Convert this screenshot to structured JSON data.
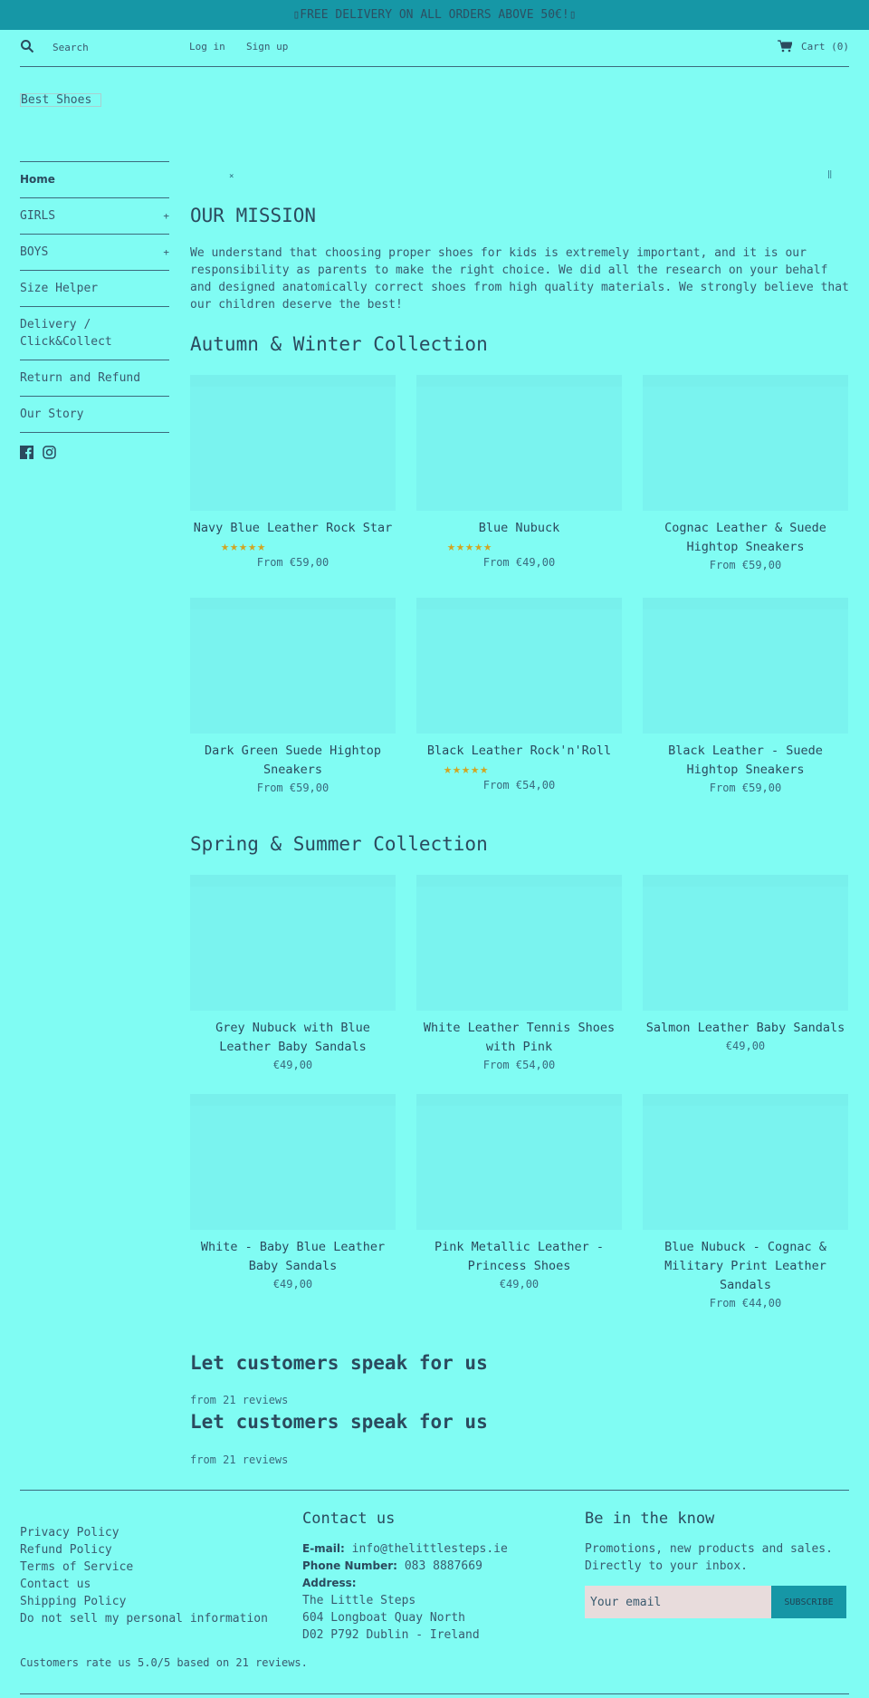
{
  "announcement": "▯FREE DELIVERY ON ALL ORDERS ABOVE 50€!▯",
  "header": {
    "search_placeholder": "Search",
    "login": "Log in",
    "signup": "Sign up",
    "cart": "Cart (0)"
  },
  "logo": "Best Shoes",
  "sidebar": {
    "items": [
      {
        "label": "Home",
        "expand": ""
      },
      {
        "label": "GIRLS",
        "expand": "+"
      },
      {
        "label": "BOYS",
        "expand": "+"
      },
      {
        "label": "Size Helper",
        "expand": ""
      },
      {
        "label": "Delivery / Click&Collect",
        "expand": ""
      },
      {
        "label": "Return and Refund",
        "expand": ""
      },
      {
        "label": "Our Story",
        "expand": ""
      }
    ],
    "social": [
      "facebook-icon",
      "instagram-icon"
    ]
  },
  "slideshow": {
    "prev_icon": "⨯",
    "pause_icon": "‖"
  },
  "mission": {
    "title": "OUR MISSION",
    "text": "We understand that choosing proper shoes for kids is extremely important, and it is our responsibility as parents to make the right choice. We did all the research on your behalf and designed anatomically correct shoes from high quality materials. We strongly believe that our children deserve the best!"
  },
  "collections": [
    {
      "title": "Autumn & Winter Collection",
      "products": [
        {
          "title": "Navy Blue Leather Rock Star",
          "stars": "★★★★★",
          "rating": 5,
          "price": "From €59,00"
        },
        {
          "title": "Blue Nubuck",
          "stars": "★★★★★",
          "rating": 5,
          "price": "From €49,00"
        },
        {
          "title": "Cognac Leather & Suede Hightop Sneakers",
          "stars": "",
          "rating": null,
          "price": "From €59,00"
        },
        {
          "title": "Dark Green Suede Hightop Sneakers",
          "stars": "",
          "rating": null,
          "price": "From €59,00"
        },
        {
          "title": "Black Leather Rock'n'Roll",
          "stars": "★★★★★",
          "rating": 5,
          "price": "From €54,00"
        },
        {
          "title": "Black Leather - Suede Hightop Sneakers",
          "stars": "",
          "rating": null,
          "price": "From €59,00"
        }
      ]
    },
    {
      "title": "Spring & Summer Collection",
      "products": [
        {
          "title": "Grey Nubuck with Blue Leather Baby Sandals",
          "stars": "",
          "rating": null,
          "price": "€49,00"
        },
        {
          "title": "White Leather Tennis Shoes with Pink",
          "stars": "",
          "rating": null,
          "price": "From €54,00"
        },
        {
          "title": "Salmon Leather Baby Sandals",
          "stars": "",
          "rating": null,
          "price": "€49,00"
        },
        {
          "title": "White - Baby Blue Leather Baby Sandals",
          "stars": "",
          "rating": null,
          "price": "€49,00"
        },
        {
          "title": "Pink Metallic Leather - Princess Shoes",
          "stars": "",
          "rating": null,
          "price": "€49,00"
        },
        {
          "title": "Blue Nubuck - Cognac & Military Print Leather Sandals",
          "stars": "",
          "rating": null,
          "price": "From €44,00"
        }
      ]
    }
  ],
  "reviews": [
    {
      "title": "Let customers speak for us",
      "sub": "from 21 reviews"
    },
    {
      "title": "Let customers speak for us",
      "sub": "from 21 reviews"
    }
  ],
  "footer": {
    "links": [
      "Privacy Policy",
      "Refund Policy",
      "Terms of Service",
      "Contact us",
      "Shipping Policy",
      "Do not sell my personal information"
    ],
    "contact": {
      "title": "Contact us",
      "email_label": "E-mail:",
      "email": "info@thelittlesteps.ie",
      "phone_label": "Phone Number:",
      "phone": "083 8887669",
      "address_label": "Address:",
      "address": [
        "The Little Steps",
        "604 Longboat Quay North",
        "D02 P792 Dublin - Ireland"
      ]
    },
    "newsletter": {
      "title": "Be in the know",
      "text": "Promotions, new products and sales. Directly to your inbox.",
      "placeholder": "Your email",
      "button": "SUBSCRIBE"
    },
    "rating_text": "Customers rate us 5.0/5 based on 21 reviews."
  },
  "colors": {
    "background": "#80fcf3",
    "accent": "#1697a6",
    "text": "#2b4a5e",
    "stars": "#d1a522"
  }
}
